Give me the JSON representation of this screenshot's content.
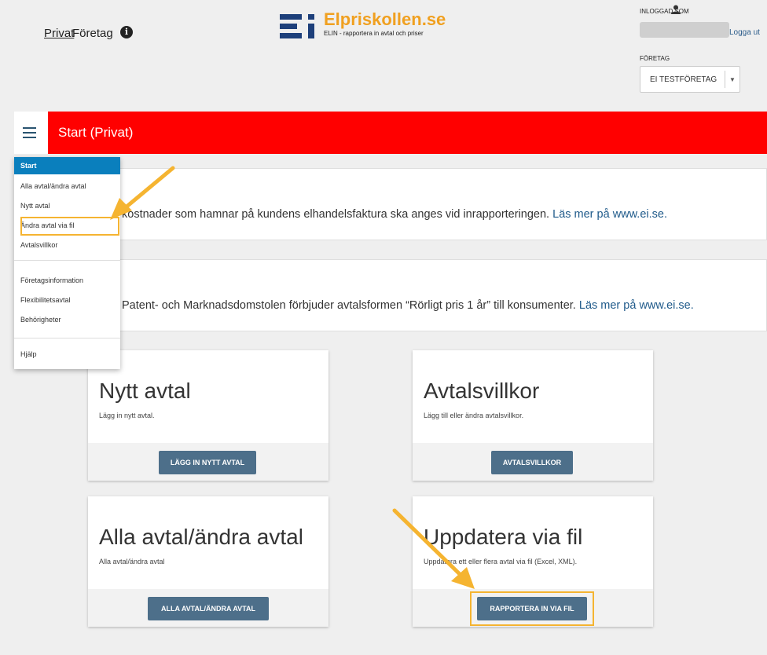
{
  "nav": {
    "privat": "Privat",
    "foretag": "Företag",
    "info_icon": "info-icon"
  },
  "logo": {
    "title": "Elpriskollen.se",
    "subtitle": "ELIN - rapportera in avtal och priser"
  },
  "account": {
    "logged_in_label": "INLOGGAD SOM",
    "logout": "Logga ut",
    "company_label": "FÖRETAG",
    "company_selected": "EI TESTFÖRETAG"
  },
  "header": {
    "title": "Start (Privat)"
  },
  "menu": {
    "items": [
      "Start",
      "Alla avtal/ändra avtal",
      "Nytt avtal",
      "Ändra avtal via fil",
      "Avtalsvillkor",
      "Företagsinformation",
      "Flexibilitetsavtal",
      "Behörigheter",
      "Hjälp"
    ]
  },
  "notices": [
    {
      "text": "kostnader som hamnar på kundens elhandelsfaktura ska anges vid inrapporteringen.",
      "link": "Läs mer på www.ei.se."
    },
    {
      "text": "Patent- och Marknadsdomstolen förbjuder avtalsformen “Rörligt pris 1 år” till konsumenter.",
      "link": "Läs mer på www.ei.se."
    }
  ],
  "cards": {
    "nytt": {
      "title": "Nytt avtal",
      "desc": "Lägg in nytt avtal.",
      "button": "LÄGG IN NYTT AVTAL"
    },
    "villkor": {
      "title": "Avtalsvillkor",
      "desc": "Lägg till eller ändra avtalsvillkor.",
      "button": "AVTALSVILLKOR"
    },
    "alla": {
      "title": "Alla avtal/ändra avtal",
      "desc": "Alla avtal/ändra avtal",
      "button": "ALLA AVTAL/ÄNDRA AVTAL"
    },
    "fil": {
      "title": "Uppdatera via fil",
      "desc": "Uppdatera ett eller flera avtal via fil (Excel, XML).",
      "button": "RAPPORTERA IN VIA FIL"
    }
  },
  "colors": {
    "header_red": "#ff0000",
    "menu_active": "#0a7fbd",
    "button": "#4d6f8a",
    "highlight": "#f5b431",
    "logo": "#f0a020"
  }
}
